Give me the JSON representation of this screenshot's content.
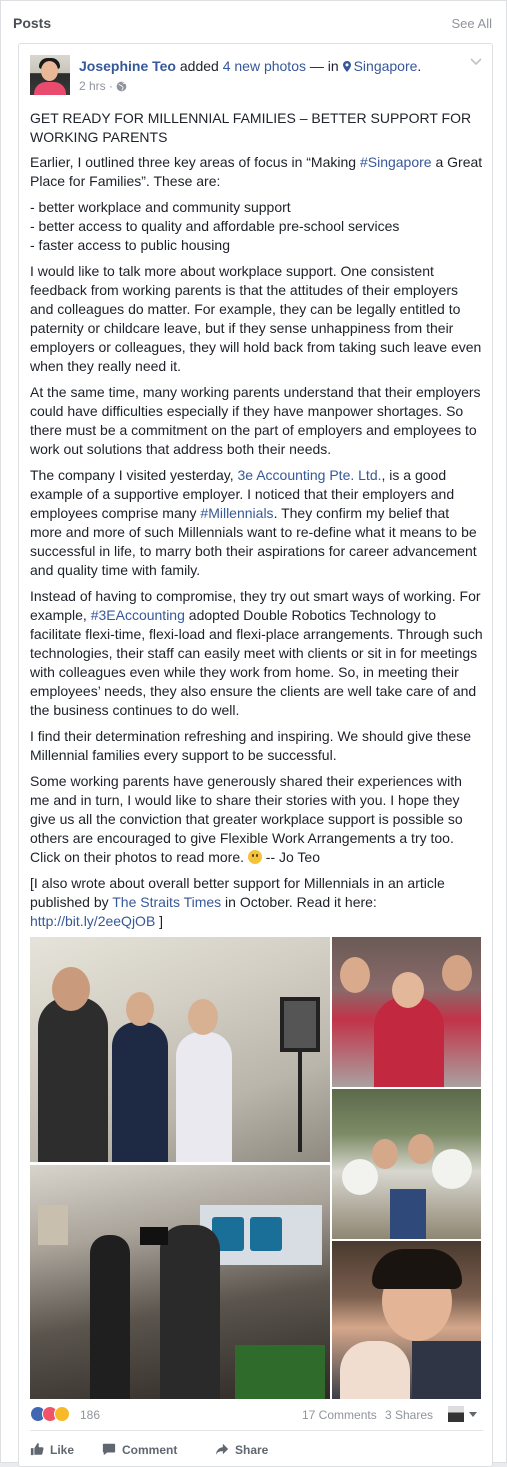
{
  "section": {
    "title": "Posts",
    "see_all": "See All"
  },
  "post": {
    "author": "Josephine Teo",
    "action_prefix": " added ",
    "action_link": "4 new photos",
    "action_mid": " — in ",
    "location": "Singapore",
    "location_suffix": ".",
    "timestamp": "2 hrs",
    "meta_sep": " · ",
    "paragraphs": {
      "p1": "GET READY FOR MILLENNIAL FAMILIES – BETTER SUPPORT FOR WORKING PARENTS",
      "p2a": "Earlier, I outlined three key areas of focus in “Making ",
      "p2_tag": "#Singapore",
      "p2b": " a Great Place for Families”. These are:",
      "list1": "- better workplace and community support",
      "list2": "- better access to quality and affordable pre-school services",
      "list3": "- faster access to public housing",
      "p3": "I would like to talk more about workplace support. One consistent feedback from working parents is that the attitudes of their employers and colleagues do matter. For example, they can be legally entitled to paternity or childcare leave, but if they sense unhappiness from their employers or colleagues, they will hold back from taking such leave even when they really need it.",
      "p4": "At the same time, many working parents understand that their employers could have difficulties especially if they have manpower shortages. So there must be a commitment on the part of employers and employees to work out solutions that address both their needs.",
      "p5a": "The company I visited yesterday, ",
      "p5_link": "3e Accounting Pte. Ltd.",
      "p5b": ", is a good example of a supportive employer. I noticed that their employers and employees comprise many ",
      "p5_tag": "#Millennials",
      "p5c": ". They confirm my belief that more and more of such Millennials want to re-define what it means to be successful in life, to marry both their aspirations for career advancement and quality time with family.",
      "p6a": "Instead of having to compromise, they try out smart ways of working. For example, ",
      "p6_tag": "#3EAccounting",
      "p6b": " adopted Double Robotics Technology to facilitate flexi-time, flexi-load and flexi-place arrangements. Through such technologies, their staff can easily meet with clients or sit in for meetings with colleagues even while they work from home. So, in meeting their employees’ needs, they also ensure the clients are well take care of and the business continues to do well.",
      "p7": "I find their determination refreshing and inspiring. We should give these Millennial families every support to be successful.",
      "p8a": "Some working parents have generously shared their experiences with me and in turn, I would like to share their stories with you. I hope they give us all the conviction that greater workplace support is possible so others are encouraged to give Flexible Work Arrangements a try too. Click on their photos to read more. ",
      "p8b": " -- Jo Teo",
      "p9a": "[I also wrote about overall better support for Millennials in an article published by ",
      "p9_link": "The Straits Times",
      "p9b": " in October. Read it here: ",
      "p9_url": "http://bit.ly/2eeQjOB",
      "p9c": " ]"
    },
    "reactions_count": "186",
    "comments": "17 Comments",
    "shares": "3 Shares",
    "actions": {
      "like": "Like",
      "comment": "Comment",
      "share": "Share"
    }
  },
  "colors": {
    "link": "#365899",
    "meta": "#90949c",
    "like_blue": "#4267b2",
    "love_red": "#f25268",
    "wow_yellow": "#f7b928"
  },
  "icons": [
    "globe-icon",
    "map-pin-icon",
    "chevron-down-icon",
    "like-icon",
    "comment-icon",
    "share-icon",
    "smiley-emoji-icon"
  ]
}
